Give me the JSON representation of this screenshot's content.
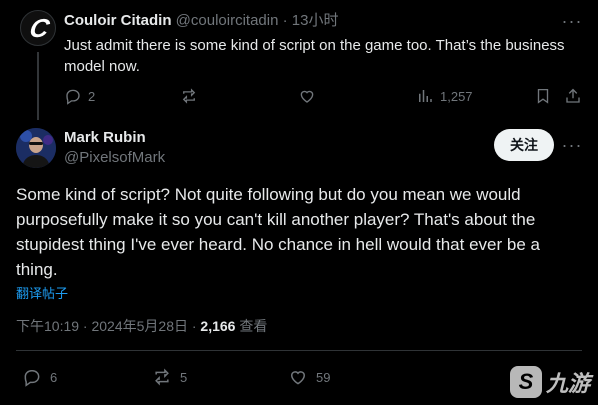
{
  "reply": {
    "author_name": "Couloir Citadin",
    "author_handle": "@couloircitadin",
    "separator": "·",
    "time": "13小时",
    "text": "Just admit there is some kind of script on the game too. That’s the business model now.",
    "actions": {
      "replies": "2",
      "views": "1,257"
    }
  },
  "tweet": {
    "author_name": "Mark Rubin",
    "author_handle": "@PixelsofMark",
    "follow_label": "关注",
    "text": "Some kind of script? Not quite following but do you mean we would purposefully make it so you can't kill another player? That's about the stupidest thing I've ever heard. No chance in hell would that ever be a thing.",
    "translate_label": "翻译帖子",
    "timestamp": "下午10:19 · 2024年5月28日 · ",
    "view_count": "2,166",
    "views_label": " 查看",
    "actions": {
      "replies": "6",
      "retweets": "5",
      "likes": "59"
    }
  },
  "icons": {
    "reply": "comment-icon",
    "retweet": "retweet-icon",
    "like": "heart-icon",
    "views": "bar-chart-icon",
    "bookmark": "bookmark-icon",
    "share": "share-icon",
    "more": "more-icon"
  },
  "colors": {
    "background": "#000000",
    "text": "#e7e9ea",
    "muted": "#71767b",
    "link": "#1d9bf0",
    "follow_bg": "#eff3f4"
  }
}
